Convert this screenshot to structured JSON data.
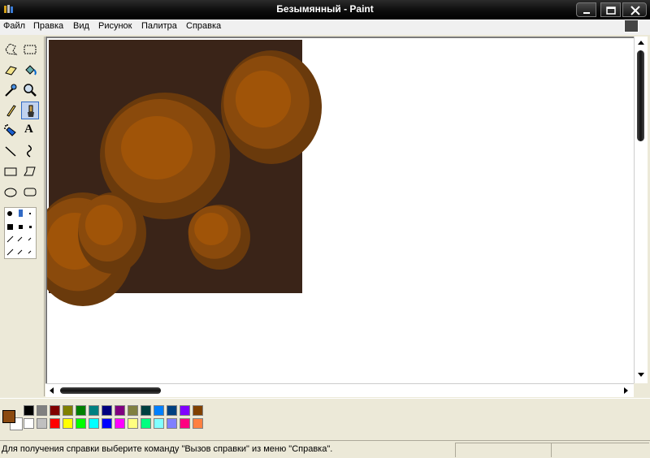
{
  "window": {
    "title": "Безымянный - Paint",
    "icon": "paint-app-icon"
  },
  "menu": {
    "items": [
      "Файл",
      "Правка",
      "Вид",
      "Рисунок",
      "Палитра",
      "Справка"
    ]
  },
  "toolbox": {
    "tools": [
      {
        "icon": "free-form-select-icon"
      },
      {
        "icon": "rect-select-icon"
      },
      {
        "icon": "eraser-icon"
      },
      {
        "icon": "fill-bucket-icon"
      },
      {
        "icon": "color-picker-icon"
      },
      {
        "icon": "magnifier-icon"
      },
      {
        "icon": "pencil-icon"
      },
      {
        "icon": "brush-icon",
        "active": true
      },
      {
        "icon": "airbrush-icon"
      },
      {
        "icon": "text-icon",
        "glyph": "A"
      },
      {
        "icon": "line-icon"
      },
      {
        "icon": "curve-icon"
      },
      {
        "icon": "rectangle-icon"
      },
      {
        "icon": "polygon-icon"
      },
      {
        "icon": "ellipse-icon"
      },
      {
        "icon": "rounded-rect-icon"
      }
    ]
  },
  "canvas": {
    "background": "#ffffff",
    "picture_background": "#3a2418",
    "blob_dark": "#6a3a0c",
    "blob_mid": "#8a4a0c",
    "blob_light": "#a05408"
  },
  "palette": {
    "foreground_color": "#8b4a10",
    "background_color": "#ffffff",
    "row1": [
      "#000000",
      "#808080",
      "#800000",
      "#808000",
      "#008000",
      "#008080",
      "#000080",
      "#800080",
      "#808040",
      "#004040",
      "#0080ff",
      "#004080",
      "#8000ff",
      "#804000"
    ],
    "row2": [
      "#ffffff",
      "#c0c0c0",
      "#ff0000",
      "#ffff00",
      "#00ff00",
      "#00ffff",
      "#0000ff",
      "#ff00ff",
      "#ffff80",
      "#00ff80",
      "#80ffff",
      "#8080ff",
      "#ff0080",
      "#ff8040"
    ]
  },
  "status": {
    "text": "Для получения справки выберите команду \"Вызов справки\" из меню \"Справка\"."
  }
}
